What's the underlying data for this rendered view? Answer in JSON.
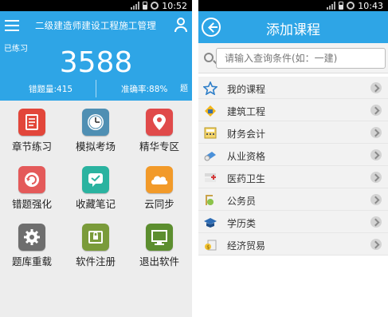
{
  "left": {
    "status_time": "10:52",
    "header": {
      "title": "二级建造师建设工程施工管理",
      "practiced_label": "已练习",
      "count": "3588",
      "unit": "题",
      "wrong_label": "错题量:415",
      "accuracy_label": "准确率:88%"
    },
    "tiles": [
      {
        "label": "章节练习",
        "icon": "document-icon"
      },
      {
        "label": "模拟考场",
        "icon": "clock-icon"
      },
      {
        "label": "精华专区",
        "icon": "map-pin-icon"
      },
      {
        "label": "错题强化",
        "icon": "refresh-icon"
      },
      {
        "label": "收藏笔记",
        "icon": "chat-check-icon"
      },
      {
        "label": "云同步",
        "icon": "cloud-icon"
      },
      {
        "label": "题库重载",
        "icon": "gear-icon"
      },
      {
        "label": "软件注册",
        "icon": "lock-icon"
      },
      {
        "label": "退出软件",
        "icon": "monitor-icon"
      }
    ],
    "colors": {
      "header": "#2ea5e6"
    }
  },
  "right": {
    "status_time": "10:43",
    "title": "添加课程",
    "search_placeholder": "请输入查询条件(如：一建)",
    "items": [
      {
        "label": "我的课程",
        "icon": "star-icon"
      },
      {
        "label": "建筑工程",
        "icon": "building-icon"
      },
      {
        "label": "财务会计",
        "icon": "calculator-icon"
      },
      {
        "label": "从业资格",
        "icon": "certificate-icon"
      },
      {
        "label": "医药卫生",
        "icon": "medical-icon"
      },
      {
        "label": "公务员",
        "icon": "official-icon"
      },
      {
        "label": "学历类",
        "icon": "graduation-icon"
      },
      {
        "label": "经济贸易",
        "icon": "trade-icon"
      }
    ]
  }
}
